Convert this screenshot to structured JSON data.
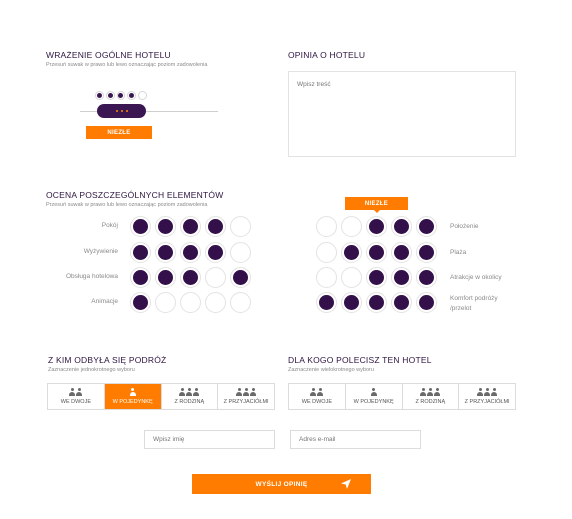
{
  "overall": {
    "title": "WRAŻENIE OGÓLNE HOTELU",
    "subtitle": "Przesuń suwak w prawo lub lewo oznaczając poziom zadowolenia",
    "badge": "NIEZŁE",
    "filled": 4,
    "total": 5
  },
  "opinion": {
    "title": "OPINIA O HOTELU",
    "placeholder": "Wpisz treść"
  },
  "elements": {
    "title": "OCENA POSZCZEGÓLNYCH ELEMENTÓW",
    "subtitle": "Przesuń suwak w prawo lub lewo oznaczając poziom zadowolenia",
    "badge": "NIEZŁE",
    "left": [
      {
        "label": "Pokój",
        "filled": [
          1,
          1,
          1,
          1,
          0
        ]
      },
      {
        "label": "Wyżywienie",
        "filled": [
          1,
          1,
          1,
          1,
          0
        ]
      },
      {
        "label": "Obsługa hotelowa",
        "filled": [
          1,
          1,
          1,
          0,
          1
        ]
      },
      {
        "label": "Animacje",
        "filled": [
          1,
          0,
          0,
          0,
          0
        ]
      }
    ],
    "right": [
      {
        "label": "Położenie",
        "filled": [
          0,
          0,
          1,
          1,
          1
        ]
      },
      {
        "label": "Plaża",
        "filled": [
          0,
          1,
          1,
          1,
          1
        ]
      },
      {
        "label": "Atrakcje w okolicy",
        "filled": [
          0,
          0,
          1,
          1,
          1
        ]
      },
      {
        "label": "Komfort podróży /przelot",
        "filled": [
          1,
          1,
          1,
          1,
          1
        ]
      }
    ]
  },
  "trip": {
    "title": "Z KIM ODBYŁA SIĘ PODRÓŻ",
    "subtitle": "Zaznaczenie jednokrotnego wyboru",
    "options": [
      "WE DWOJE",
      "W POJEDYNKĘ",
      "Z RODZINĄ",
      "Z PRZYJACIÓŁMI"
    ],
    "selected": 1
  },
  "recommend": {
    "title": "DLA KOGO POLECISZ TEN HOTEL",
    "subtitle": "Zaznaczenie wielokrotnego wyboru",
    "options": [
      "WE DWOJE",
      "W POJEDYNKĘ",
      "Z RODZINĄ",
      "Z PRZYJACIÓŁMI"
    ]
  },
  "form": {
    "name_placeholder": "Wpisz imię",
    "email_placeholder": "Adres e-mail",
    "submit_label": "WYŚLIJ OPINIĘ"
  },
  "colors": {
    "accent": "#ff7c00",
    "brand": "#33104a"
  }
}
